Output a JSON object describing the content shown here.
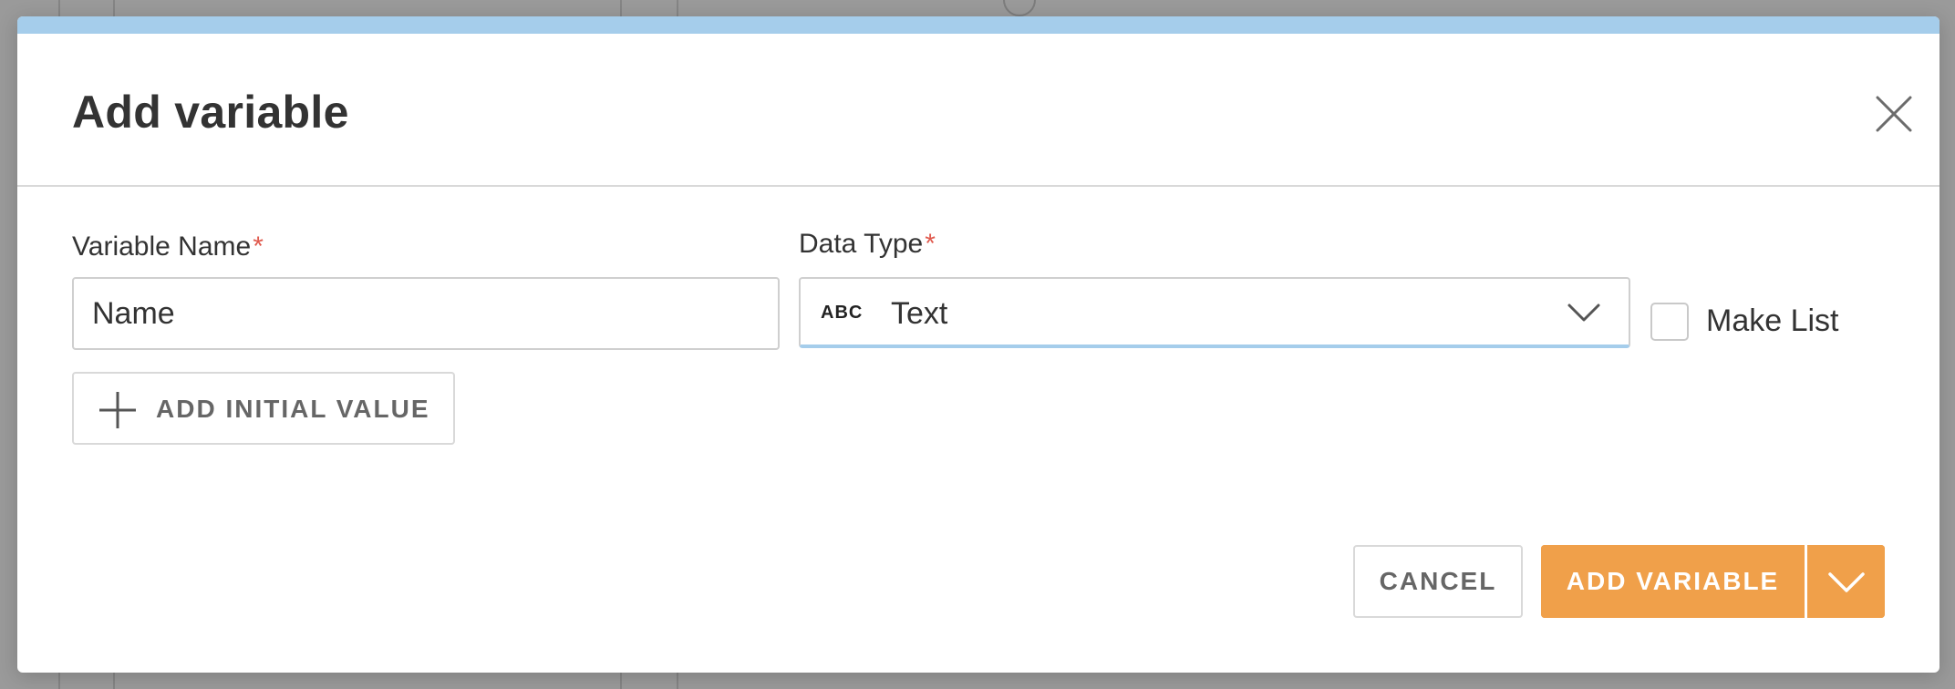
{
  "dialog": {
    "title": "Add variable",
    "close_icon": "close-icon"
  },
  "form": {
    "variable_name": {
      "label": "Variable Name",
      "required_mark": "*",
      "value": "Name"
    },
    "data_type": {
      "label": "Data Type",
      "required_mark": "*",
      "icon_text": "ABC",
      "selected": "Text"
    },
    "make_list": {
      "label": "Make List",
      "checked": false
    },
    "add_initial_value": {
      "label": "ADD INITIAL VALUE",
      "icon": "plus-icon"
    }
  },
  "footer": {
    "cancel_label": "CANCEL",
    "add_variable_label": "ADD VARIABLE",
    "dropdown_icon": "chevron-down-icon"
  },
  "colors": {
    "accent_orange": "#f0a04a",
    "top_bar_blue": "#a5cdeb",
    "required_red": "#e05a4e",
    "overlay_gray": "#9a9a9a"
  }
}
